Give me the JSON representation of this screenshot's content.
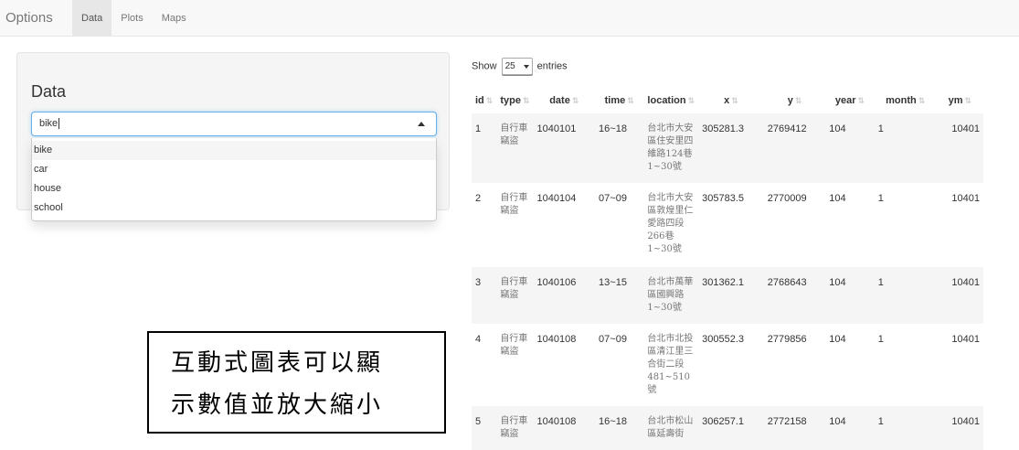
{
  "navbar": {
    "brand": "Options",
    "tabs": [
      {
        "label": "Data",
        "active": true
      },
      {
        "label": "Plots",
        "active": false
      },
      {
        "label": "Maps",
        "active": false
      }
    ]
  },
  "sidebar": {
    "title": "Data",
    "select": {
      "value": "bike",
      "options": [
        "bike",
        "car",
        "house",
        "school"
      ],
      "highlighted": "bike"
    }
  },
  "table": {
    "length_prefix": "Show",
    "length_value": "25",
    "length_suffix": "entries",
    "columns": [
      "id",
      "type",
      "date",
      "time",
      "location",
      "x",
      "y",
      "year",
      "month",
      "ym"
    ],
    "rows": [
      {
        "id": "1",
        "type": "自行車竊盜",
        "date": "1040101",
        "time": "16~18",
        "location": "台北市大安區住安里四維路124巷1~30號",
        "x": "305281.3",
        "y": "2769412",
        "year": "104",
        "month": "1",
        "ym": "10401"
      },
      {
        "id": "2",
        "type": "自行車竊盜",
        "date": "1040104",
        "time": "07~09",
        "location": "台北市大安區敦煌里仁愛路四段266巷1~30號",
        "x": "305783.5",
        "y": "2770009",
        "year": "104",
        "month": "1",
        "ym": "10401"
      },
      {
        "id": "3",
        "type": "自行車竊盜",
        "date": "1040106",
        "time": "13~15",
        "location": "台北市萬華區國興路1~30號",
        "x": "301362.1",
        "y": "2768643",
        "year": "104",
        "month": "1",
        "ym": "10401"
      },
      {
        "id": "4",
        "type": "自行車竊盜",
        "date": "1040108",
        "time": "07~09",
        "location": "台北市北投區清江里三合街二段481~510號",
        "x": "300552.3",
        "y": "2779856",
        "year": "104",
        "month": "1",
        "ym": "10401"
      },
      {
        "id": "5",
        "type": "自行車竊盜",
        "date": "1040108",
        "time": "16~18",
        "location": "台北市松山區延壽街",
        "x": "306257.1",
        "y": "2772158",
        "year": "104",
        "month": "1",
        "ym": "10401"
      }
    ]
  },
  "annotation": {
    "line1": "互動式圖表可以顯",
    "line2": "示數值並放大縮小"
  },
  "colors": {
    "navbar_bg": "#f8f8f8",
    "active_tab_bg": "#e7e7e7",
    "focus_border": "#66afe9",
    "stripe": "#f5f5f5"
  }
}
